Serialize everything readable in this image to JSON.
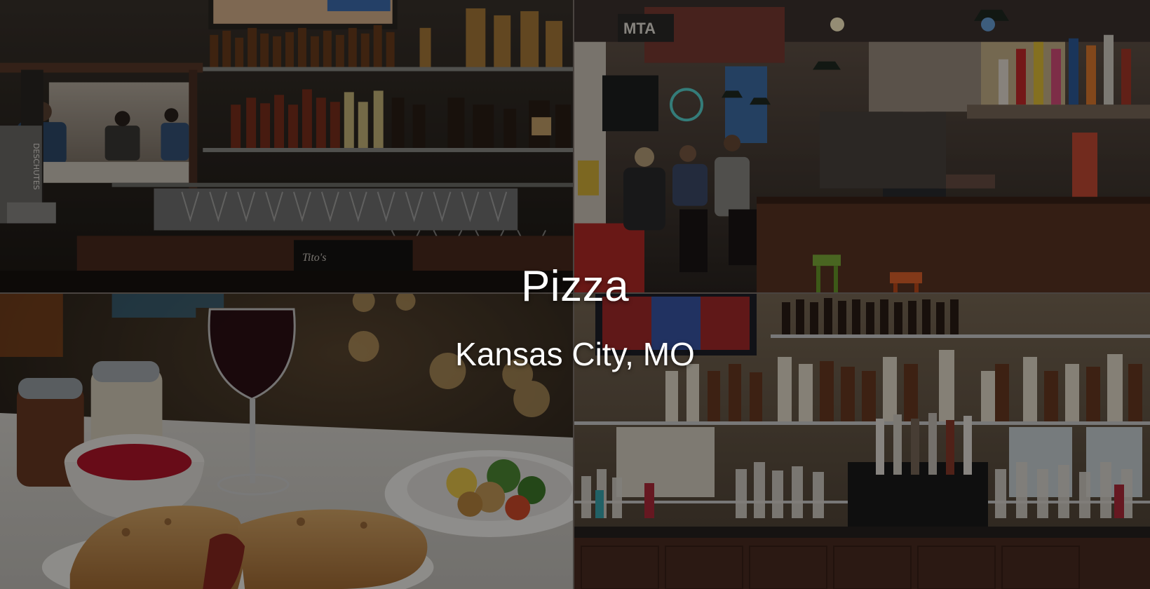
{
  "hero": {
    "title": "Pizza",
    "subtitle": "Kansas City, MO"
  },
  "photo_tiles": [
    {
      "name": "bar-bottle-shelves-photo"
    },
    {
      "name": "bar-counter-patrons-photo"
    },
    {
      "name": "calzone-salad-wine-photo"
    },
    {
      "name": "liquor-wall-taps-photo"
    }
  ],
  "visible_signage": {
    "neon_sign": "MTA",
    "liquor_box": "Tito's",
    "tap_handle": "DESCHUTES"
  },
  "colors": {
    "overlay_text": "#ffffff",
    "image_dim": "rgba(0,0,0,0.42)",
    "wood_bar": "#5a3424",
    "stool_green": "#7fae3a",
    "stool_orange": "#e0622c",
    "sauce_red": "#b3162a"
  }
}
